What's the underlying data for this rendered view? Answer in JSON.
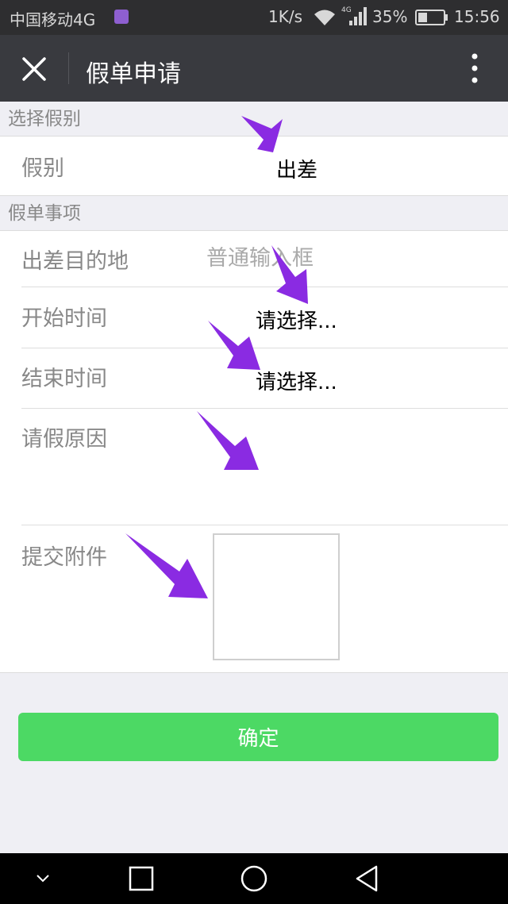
{
  "status_bar": {
    "carrier": "中国移动4G",
    "speed": "1K/s",
    "network_badge": "4G",
    "battery_percent": "35%",
    "time": "15:56"
  },
  "title_bar": {
    "title": "假单申请",
    "close_icon": "close-icon",
    "more_icon": "more-vertical-icon"
  },
  "sections": {
    "type_header": "选择假别",
    "details_header": "假单事项"
  },
  "leave_type": {
    "label": "假别",
    "value": "出差"
  },
  "destination": {
    "label": "出差目的地",
    "placeholder": "普通输入框"
  },
  "start_time": {
    "label": "开始时间",
    "value": "请选择..."
  },
  "end_time": {
    "label": "结束时间",
    "value": "请选择..."
  },
  "reason": {
    "label": "请假原因"
  },
  "attachment": {
    "label": "提交附件"
  },
  "confirm_button": {
    "label": "确定"
  },
  "colors": {
    "accent": "#4cd964",
    "annotation_arrow": "#8a2be2",
    "title_bar": "#393a3f"
  }
}
